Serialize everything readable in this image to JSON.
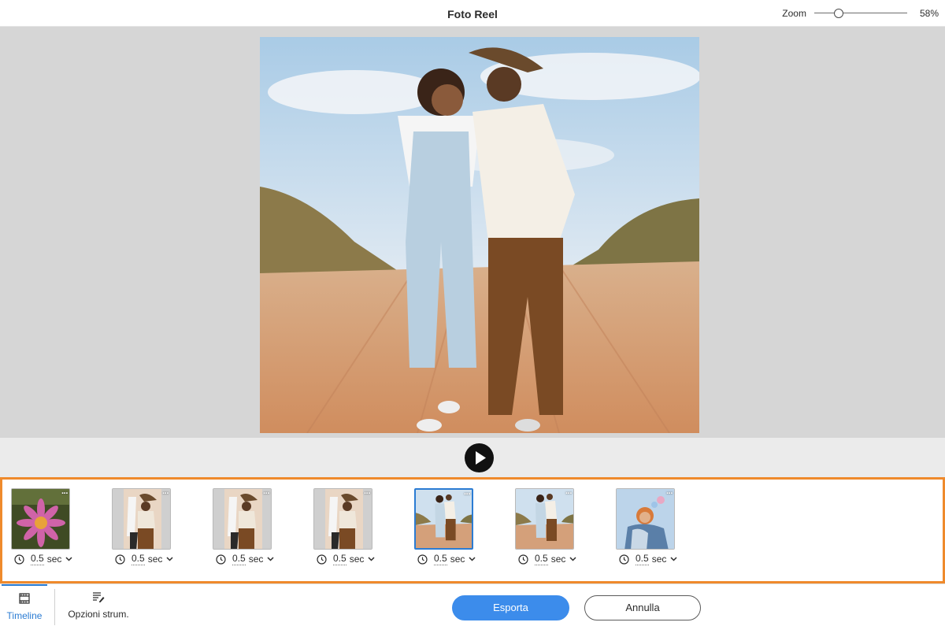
{
  "header": {
    "title": "Foto Reel",
    "zoom_label": "Zoom",
    "zoom_value": "58%",
    "zoom_level": 0.24
  },
  "preview": {
    "image": "couple-walking-dirt-road"
  },
  "player": {
    "play_icon": "play-icon"
  },
  "filmstrip": {
    "accent": "#ef8a2c",
    "selected_index": 4,
    "clips": [
      {
        "image": "pink-flower",
        "duration": "0.5",
        "unit": "sec"
      },
      {
        "image": "couple-walking-masked",
        "duration": "0.5",
        "unit": "sec"
      },
      {
        "image": "couple-walking-masked",
        "duration": "0.5",
        "unit": "sec"
      },
      {
        "image": "couple-walking-masked",
        "duration": "0.5",
        "unit": "sec"
      },
      {
        "image": "couple-walking-dirt-road",
        "duration": "0.5",
        "unit": "sec"
      },
      {
        "image": "couple-walking-dirt-road",
        "duration": "0.5",
        "unit": "sec"
      },
      {
        "image": "couple-hugging-balloons",
        "duration": "0.5",
        "unit": "sec"
      }
    ]
  },
  "bottom": {
    "tabs": [
      {
        "label": "Timeline",
        "icon": "film-icon"
      },
      {
        "label": "Opzioni strum.",
        "icon": "tool-options-icon"
      }
    ],
    "export_label": "Esporta",
    "cancel_label": "Annulla",
    "accent": "#3c8ceb"
  }
}
